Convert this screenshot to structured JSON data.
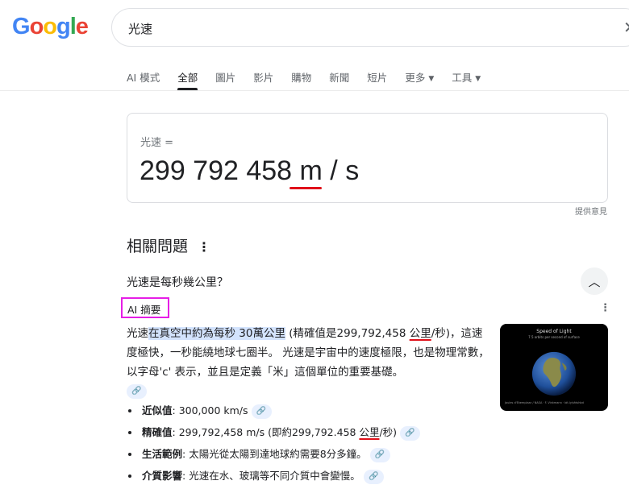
{
  "logo": {
    "letters": [
      "G",
      "o",
      "o",
      "g",
      "l",
      "e"
    ],
    "colors": [
      "#4285f4",
      "#ea4335",
      "#fbbc05",
      "#4285f4",
      "#34a853",
      "#ea4335"
    ]
  },
  "search": {
    "query": "光速",
    "clear_icon": "close-icon"
  },
  "tabs": [
    {
      "label": "AI 模式"
    },
    {
      "label": "全部",
      "active": true
    },
    {
      "label": "圖片"
    },
    {
      "label": "影片"
    },
    {
      "label": "購物"
    },
    {
      "label": "新聞"
    },
    {
      "label": "短片"
    },
    {
      "label": "更多",
      "dropdown": true
    },
    {
      "label": "工具",
      "dropdown": true
    }
  ],
  "converter": {
    "label": "光速 =",
    "number": "299 792 458",
    "unit_m": "m",
    "unit_rest": " / s",
    "feedback": "提供意見"
  },
  "related": {
    "title": "相關問題",
    "question": "光速是每秒幾公里？",
    "ai_badge": "AI 摘要",
    "answer": {
      "p1": "光速",
      "hl": "在真空中約為每秒 30萬公里",
      "p2": " (精確值是299,792,458 ",
      "u1": "公里",
      "p3": "/秒)，這速度極快，一秒能繞地球七圈半。 光速是宇宙中的速度極限，也是物理常數，以字母'c' 表示，並且是定義「米」這個單位的重要基礎。"
    },
    "image": {
      "title": "Speed of Light",
      "subtitle": "7.5 orbits per second of surface",
      "credit": "Joules d'Ekemplaar / NASA  ·  F. Vinkmann  ·  bit.ly/sfdshbd"
    },
    "bullets": [
      {
        "label": "近似值",
        "text": ": 300,000 km/s"
      },
      {
        "label": "精確值",
        "text": ": 299,792,458 m/s (即約299,792.458 ",
        "ul": "公里",
        "tail": "/秒)"
      },
      {
        "label": "生活範例",
        "text": ": 太陽光從太陽到達地球約需要8分多鐘。"
      },
      {
        "label": "介質影響",
        "text": ": 光速在水、玻璃等不同介質中會變慢。"
      }
    ]
  }
}
